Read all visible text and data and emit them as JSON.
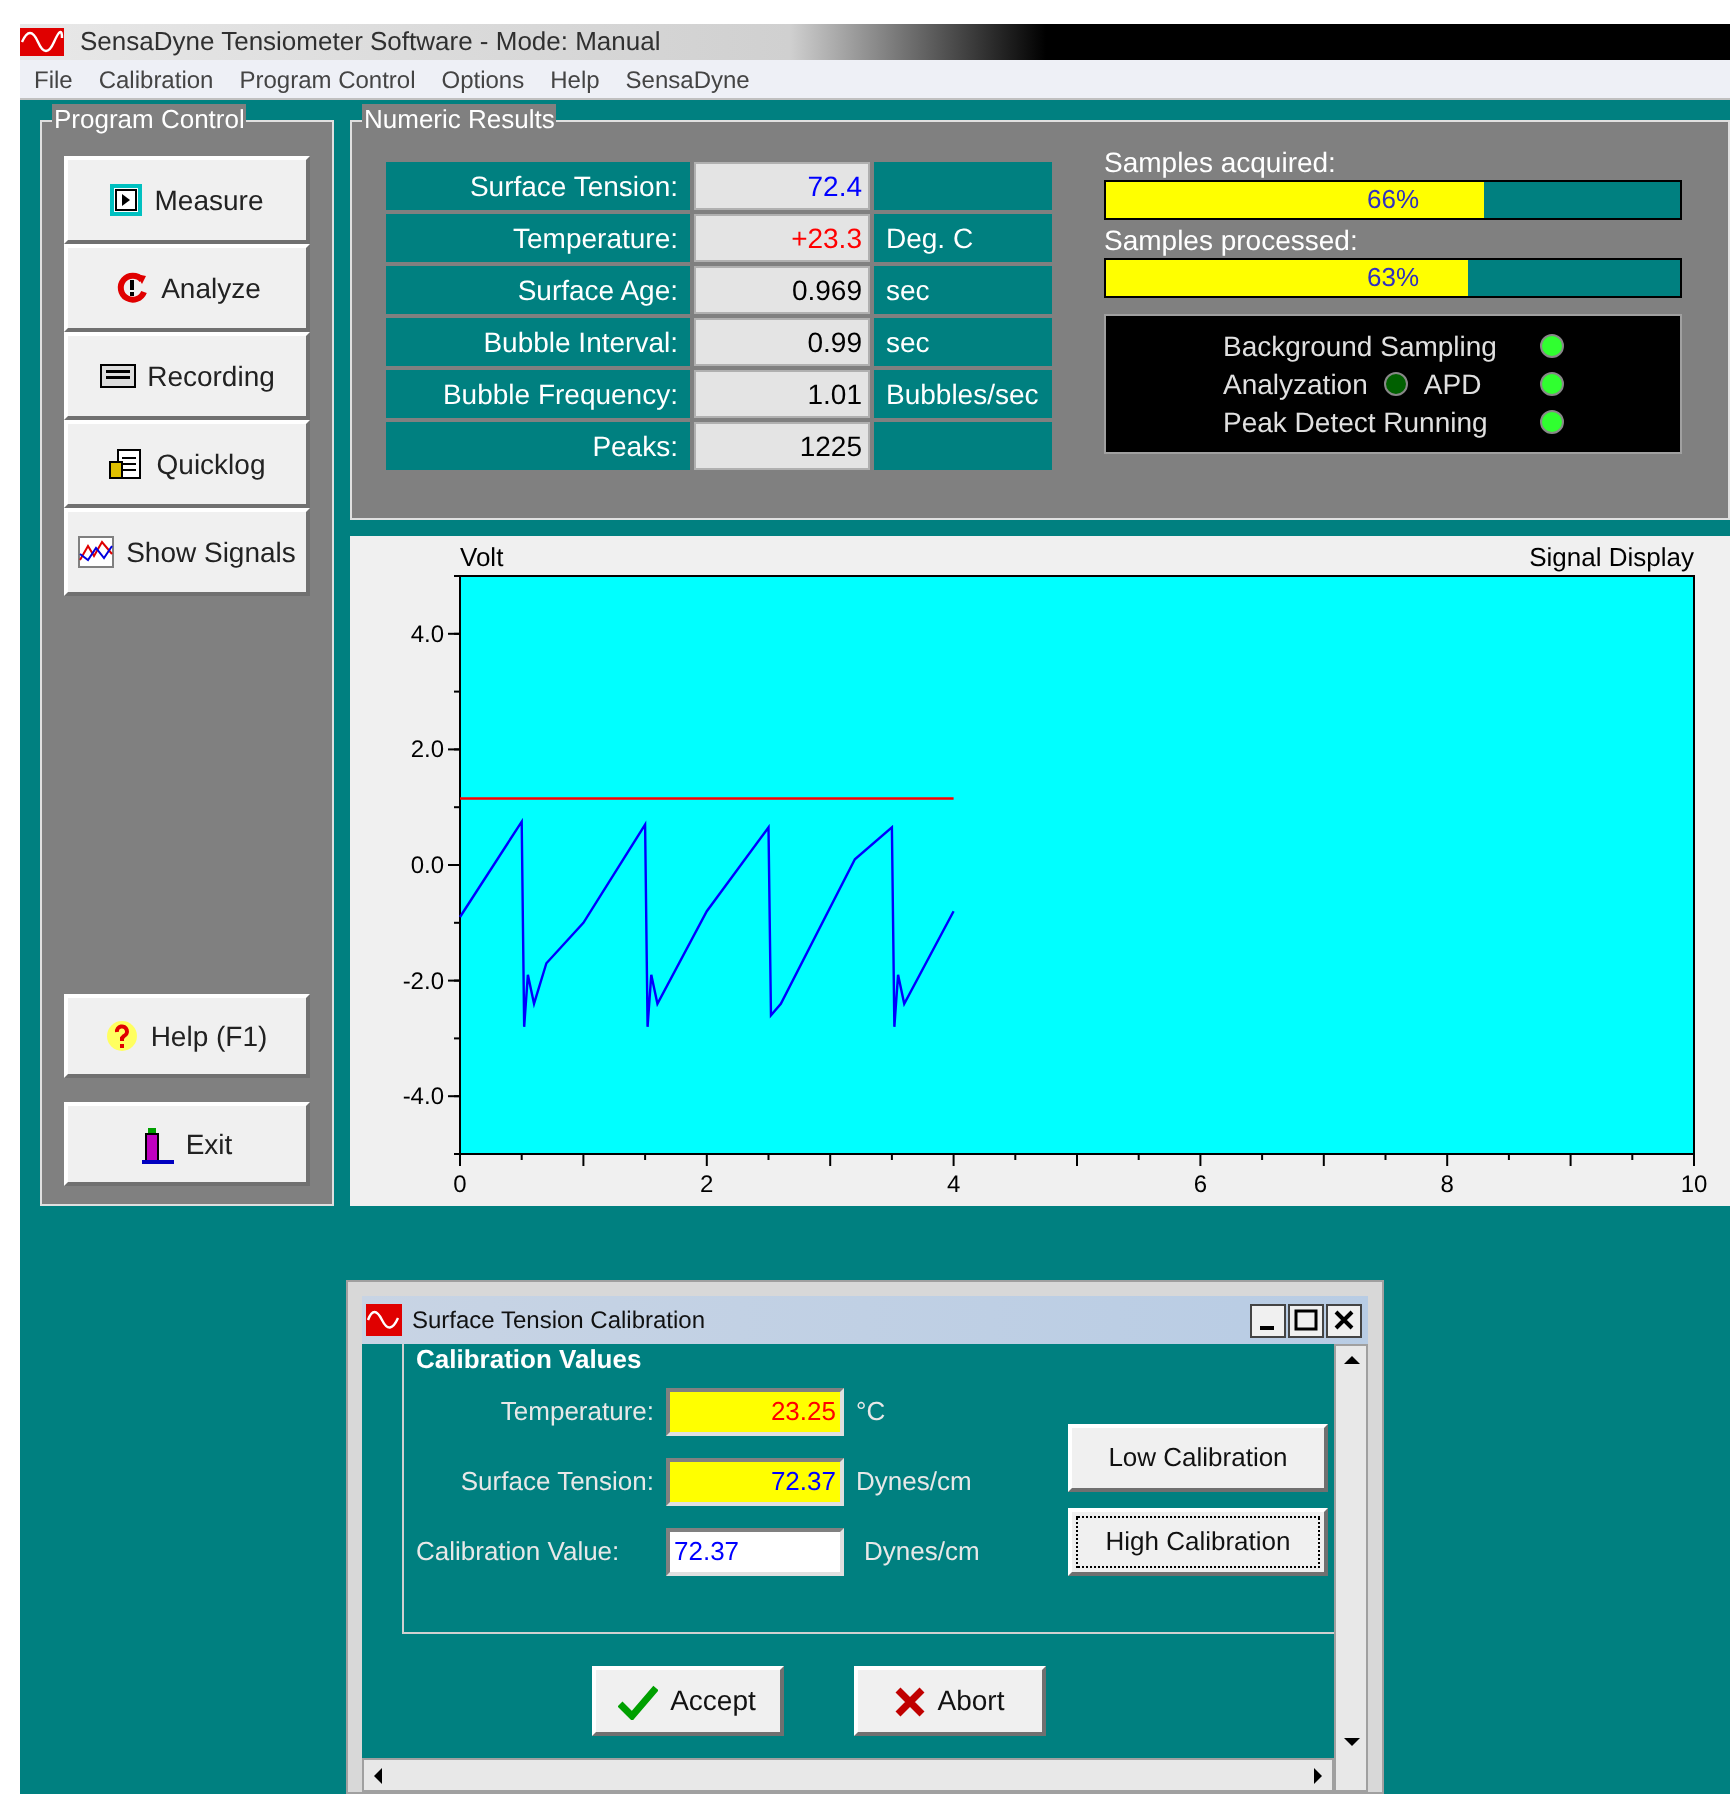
{
  "window": {
    "title": "SensaDyne Tensiometer Software - Mode: Manual"
  },
  "menu": [
    "File",
    "Calibration",
    "Program Control",
    "Options",
    "Help",
    "SensaDyne"
  ],
  "program_control": {
    "title": "Program Control",
    "buttons": [
      {
        "label": "Measure",
        "kind": "measure"
      },
      {
        "label": "Analyze",
        "kind": "analyze"
      },
      {
        "label": "Recording",
        "kind": "recording"
      },
      {
        "label": "Quicklog",
        "kind": "quicklog"
      },
      {
        "label": "Show Signals",
        "kind": "signals"
      }
    ],
    "bottom_buttons": [
      {
        "label": "Help (F1)",
        "kind": "help"
      },
      {
        "label": "Exit",
        "kind": "exit"
      }
    ]
  },
  "numeric_results": {
    "title": "Numeric Results",
    "rows": [
      {
        "label": "Surface Tension:",
        "value": "72.4",
        "unit": "",
        "color": "#0000ff"
      },
      {
        "label": "Temperature:",
        "value": "+23.3",
        "unit": "Deg. C",
        "color": "#ff0000"
      },
      {
        "label": "Surface Age:",
        "value": "0.969",
        "unit": "sec",
        "color": "#000000"
      },
      {
        "label": "Bubble Interval:",
        "value": "0.99",
        "unit": "sec",
        "color": "#000000"
      },
      {
        "label": "Bubble Frequency:",
        "value": "1.01",
        "unit": "Bubbles/sec",
        "color": "#000000"
      },
      {
        "label": "Peaks:",
        "value": "1225",
        "unit": "",
        "color": "#000000"
      }
    ],
    "progress": [
      {
        "label": "Samples acquired:",
        "level": 0.66,
        "reading": "66%"
      },
      {
        "label": "Samples processed:",
        "level": 0.63,
        "reading": "63%"
      }
    ],
    "indicators": [
      [
        {
          "label": "Background Sampling",
          "on": true
        }
      ],
      [
        {
          "label": "Analyzation",
          "on": false
        },
        {
          "label": "APD",
          "on": true
        }
      ],
      [
        {
          "label": "Peak Detect Running",
          "on": true
        }
      ]
    ]
  },
  "signal_display": {
    "chart_data": {
      "type": "line",
      "title": "Signal Display",
      "ylabel": "Volt",
      "xlim": [
        0,
        10
      ],
      "ylim": [
        -5,
        5
      ],
      "xticks": [
        0,
        2,
        4,
        6,
        8,
        10
      ],
      "yticks": [
        {
          "value": 4,
          "label": "4.0"
        },
        {
          "value": 2,
          "label": "2.0"
        },
        {
          "value": 0,
          "label": "0.0"
        },
        {
          "value": -2,
          "label": "-2.0"
        },
        {
          "value": -4,
          "label": "-4.0"
        }
      ],
      "x": [
        0,
        0.5,
        0.52,
        0.55,
        0.6,
        0.7,
        1,
        1.5,
        1.52,
        1.55,
        1.6,
        2,
        2.5,
        2.52,
        2.6,
        3.2,
        3.5,
        3.52,
        3.55,
        3.6,
        4
      ],
      "series": [
        {
          "color": "#ff0000",
          "values": [
            1.15,
            1.15,
            1.15,
            1.15,
            1.15,
            1.15,
            1.15,
            1.15,
            1.15,
            1.15,
            1.15,
            1.15,
            1.15,
            1.15,
            1.15,
            1.15,
            1.15,
            1.15,
            1.15,
            1.15,
            1.15
          ]
        },
        {
          "color": "#0000ff",
          "values": [
            -0.9,
            0.75,
            -2.8,
            -1.9,
            -2.4,
            -1.7,
            -1.0,
            0.7,
            -2.8,
            -1.9,
            -2.4,
            -0.8,
            0.65,
            -2.6,
            -2.4,
            0.1,
            0.65,
            -2.8,
            -1.9,
            -2.4,
            -0.8
          ]
        }
      ]
    }
  },
  "dialog": {
    "title": "Surface Tension Calibration",
    "group": "Calibration Values",
    "fields": [
      {
        "label": "Temperature:",
        "value": "23.25",
        "unit": "°C",
        "highlighted": true,
        "color": "#ff0000"
      },
      {
        "label": "Surface Tension:",
        "value": "72.37",
        "unit": "Dynes/cm",
        "highlighted": true,
        "color": "#0000ff"
      },
      {
        "label": "Calibration Value:",
        "value": "72.37",
        "unit": "Dynes/cm",
        "highlighted": false,
        "color": "#0000ff"
      }
    ],
    "side_buttons": [
      {
        "label": "Low Calibration",
        "focused": false
      },
      {
        "label": "High Calibration",
        "focused": true
      }
    ],
    "buttons": [
      {
        "label": "Accept",
        "kind": "accept"
      },
      {
        "label": "Abort",
        "kind": "abort"
      }
    ]
  }
}
